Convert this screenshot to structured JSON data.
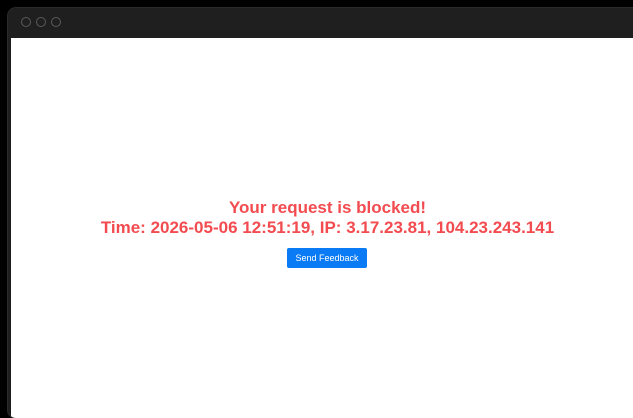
{
  "window": {
    "controls": [
      "close-icon",
      "minimize-icon",
      "maximize-icon"
    ]
  },
  "page": {
    "heading": "Your request is blocked!",
    "details": "Time: 2026-05-06 12:51:19, IP: 3.17.23.81, 104.23.243.141",
    "feedback_button_label": "Send Feedback"
  },
  "colors": {
    "message": "#f24b50",
    "button": "#0b7bf5",
    "titlebar": "#1f1f1f",
    "background": "#ffffff"
  }
}
